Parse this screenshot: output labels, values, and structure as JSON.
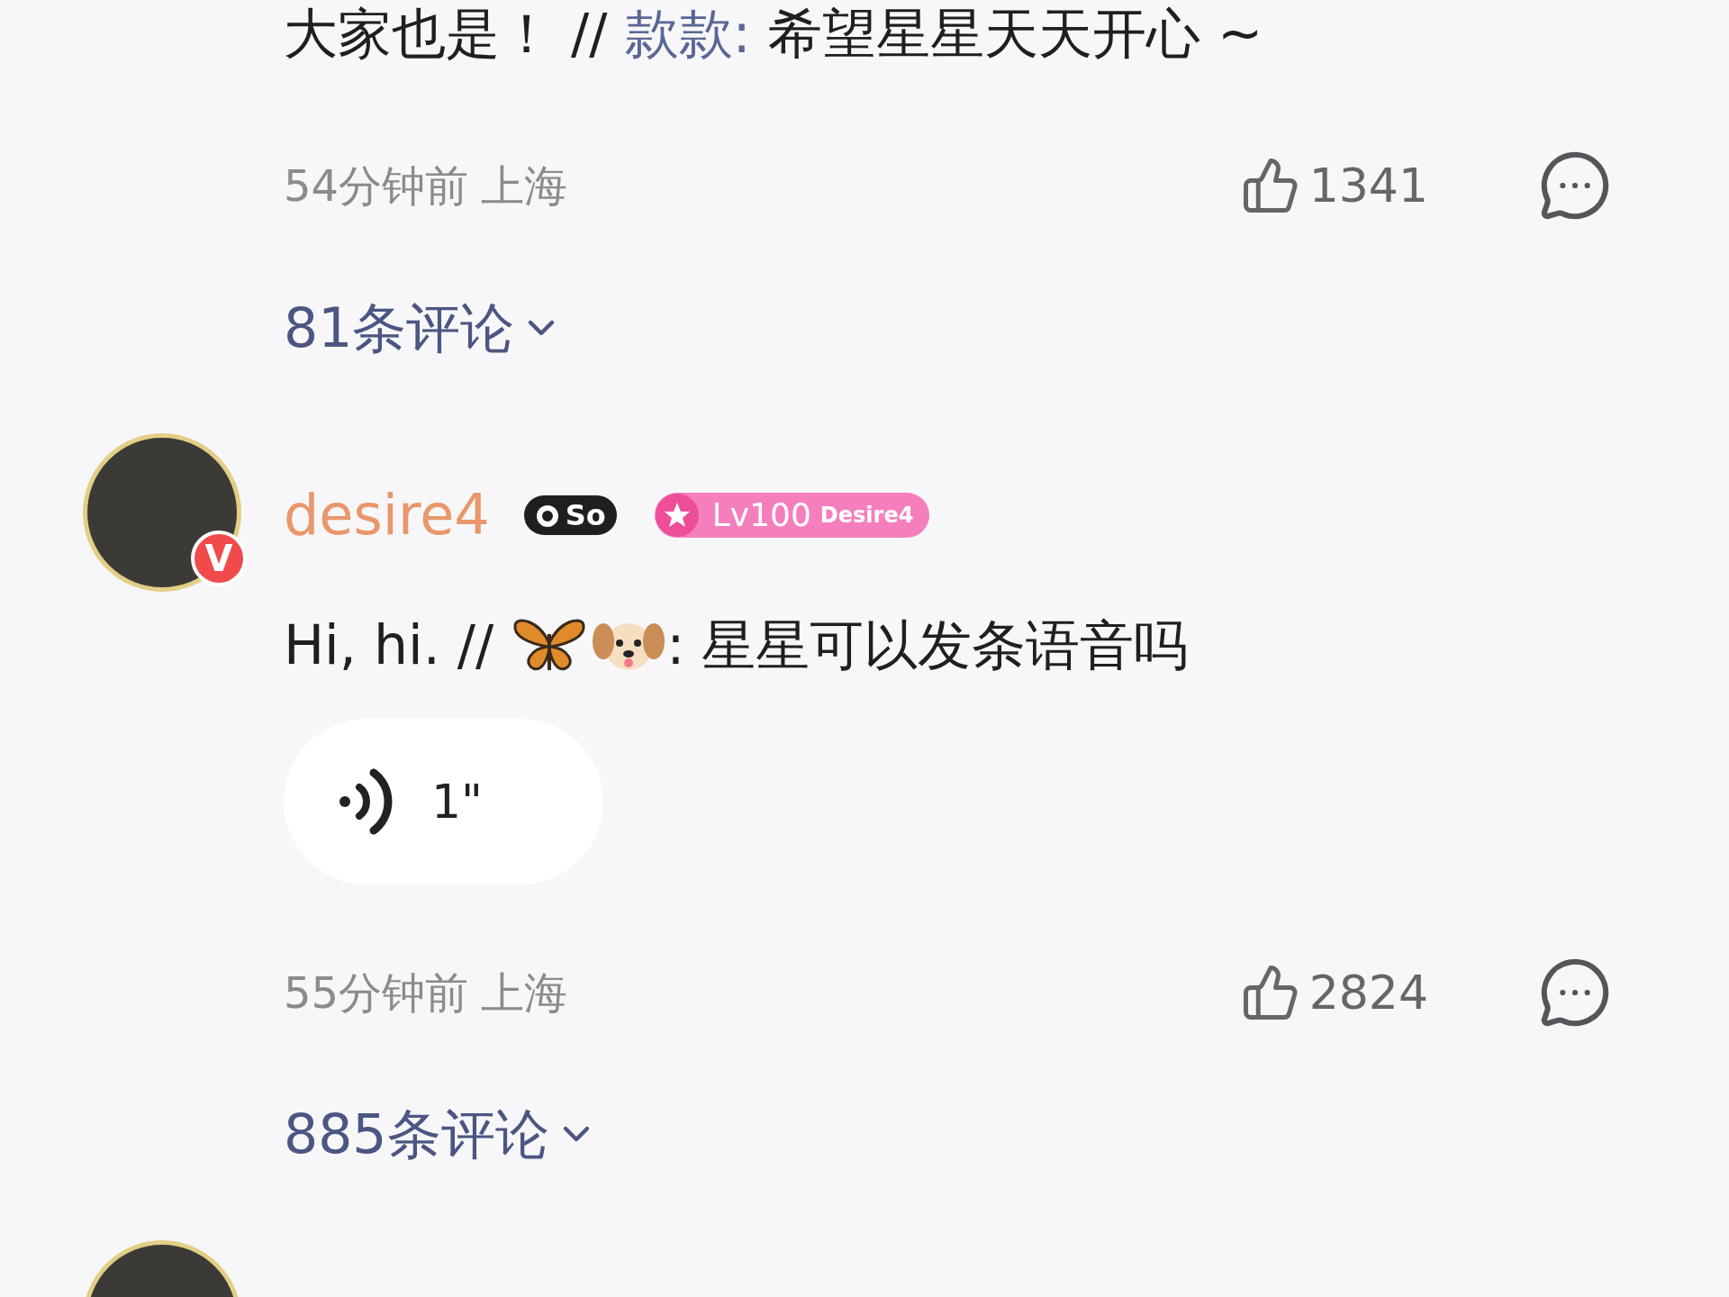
{
  "top_comment": {
    "text": "大家也是！ //",
    "mention": "款款:",
    "rest": "希望星星天天开心 ~",
    "time": "54分钟前",
    "location": "上海",
    "likes": "1341",
    "replies": "81条评论"
  },
  "comment": {
    "username": "desire4",
    "verified_mark": "V",
    "fan_badge": "So",
    "level_badge": {
      "level": "Lv100",
      "name": "Desire4"
    },
    "text_before": "Hi, hi. //",
    "text_after": ": 星星可以发条语音吗",
    "voice": {
      "duration": "1\""
    },
    "time": "55分钟前",
    "location": "上海",
    "likes": "2824",
    "replies": "885条评论"
  }
}
